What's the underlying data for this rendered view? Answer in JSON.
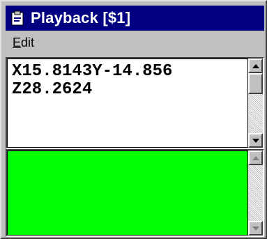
{
  "window": {
    "title": "Playback [$1]",
    "title_icon": "clipboard-icon"
  },
  "menu": {
    "items": [
      {
        "label_accel": "E",
        "label_rest": "dit"
      }
    ]
  },
  "output": {
    "lines": [
      "X15.8143Y-14.856",
      "Z28.2624"
    ]
  },
  "status_pane": {
    "color": "#00ff00"
  },
  "colors": {
    "titlebar": "#000080",
    "window_face": "#c0c0c0"
  }
}
